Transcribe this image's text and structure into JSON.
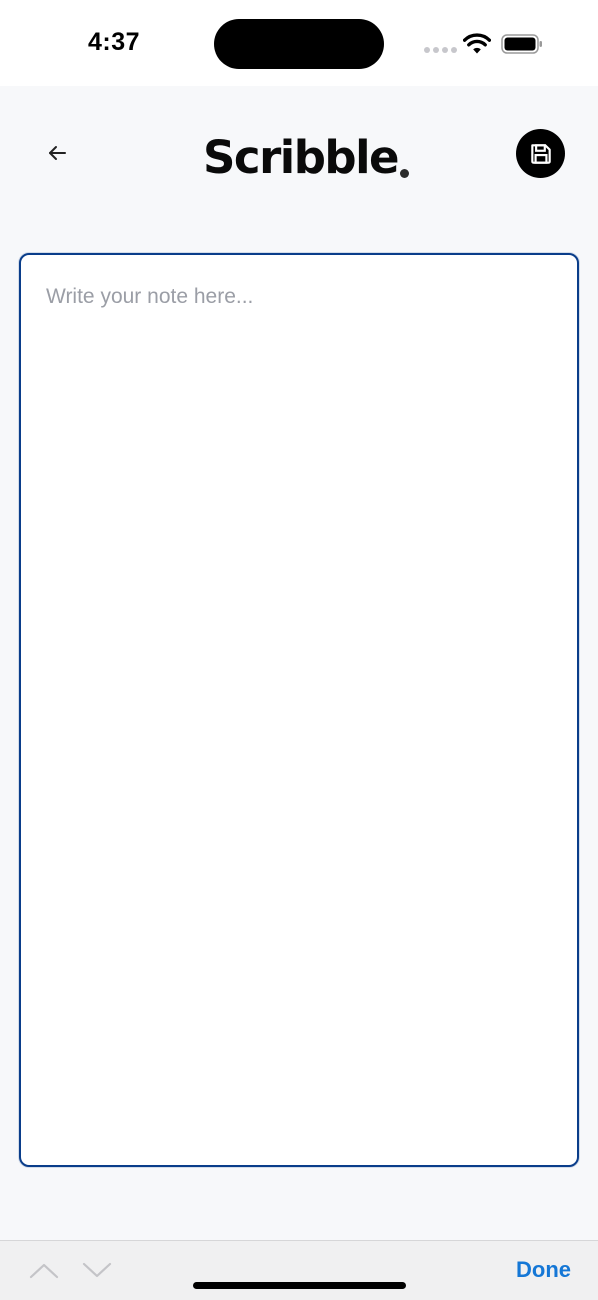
{
  "status_bar": {
    "time": "4:37",
    "icons": [
      "signal-icon",
      "wifi-icon",
      "battery-icon"
    ]
  },
  "header": {
    "logo_text": "Scribble",
    "back_icon": "arrow-left-icon",
    "save_icon": "floppy-disk-icon"
  },
  "editor": {
    "value": "",
    "placeholder": "Write your note here..."
  },
  "accessory_bar": {
    "prev_icon": "chevron-up-icon",
    "next_icon": "chevron-down-icon",
    "done_label": "Done"
  },
  "colors": {
    "accent": "#1577d6",
    "editor_border": "#0a3d8a",
    "background": "#f7f8fa",
    "placeholder": "#9b9ea6"
  }
}
